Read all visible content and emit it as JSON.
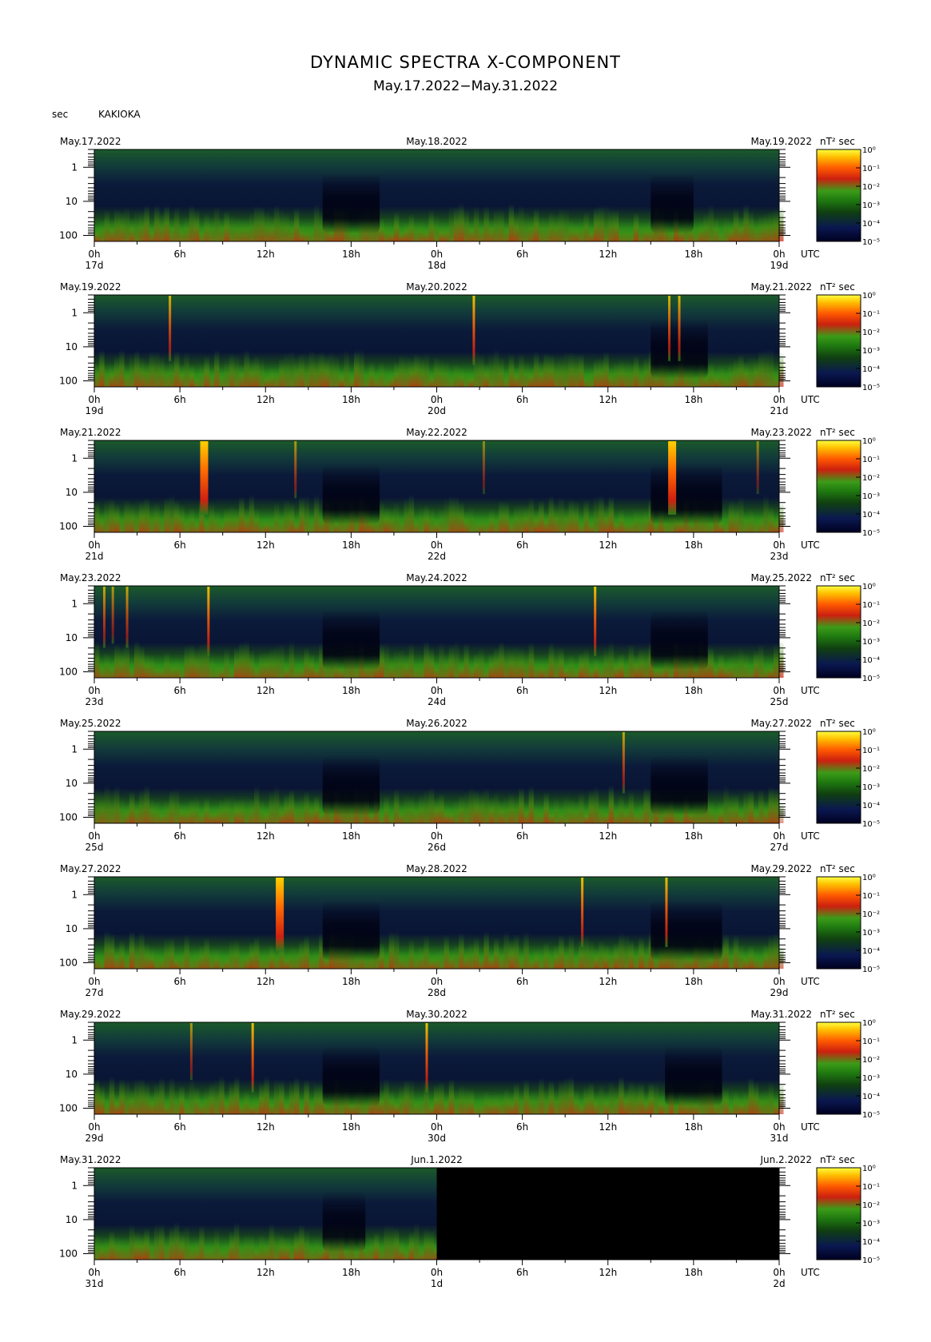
{
  "header": {
    "title": "DYNAMIC SPECTRA X-COMPONENT",
    "subtitle": "May.17.2022−May.31.2022",
    "unit_label": "sec",
    "station": "KAKIOKA"
  },
  "colors": {
    "colorbar": [
      "#000020",
      "#0a1850",
      "#104010",
      "#1f7a10",
      "#3c9b18",
      "#cc2010",
      "#ff5a00",
      "#ffc000",
      "#ffff40"
    ],
    "background_panel": "#0b1a3a",
    "no_data": "#000000"
  },
  "chart_data": {
    "type": "heatmap",
    "y_axis": {
      "label": "sec",
      "scale": "log",
      "ticks": [
        "1",
        "10",
        "100"
      ]
    },
    "x_axis": {
      "ticks": [
        "0h",
        "6h",
        "12h",
        "18h",
        "0h",
        "6h",
        "12h",
        "18h",
        "0h"
      ],
      "end_label": "UTC"
    },
    "colorbar": {
      "unit": "nT² sec",
      "ticks": [
        "10⁰",
        "10⁻¹",
        "10⁻²",
        "10⁻³",
        "10⁻⁴",
        "10⁻⁵"
      ]
    },
    "panels": [
      {
        "date_left": "May.17.2022",
        "date_mid": "May.18.2022",
        "date_right": "May.19.2022",
        "day_labels": [
          "17d",
          "18d",
          "19d"
        ],
        "data_until_hour": 48,
        "events": [],
        "quiet": [
          [
            16,
            20
          ],
          [
            39,
            42
          ]
        ]
      },
      {
        "date_left": "May.19.2022",
        "date_mid": "May.20.2022",
        "date_right": "May.21.2022",
        "day_labels": [
          "19d",
          "20d",
          "21d"
        ],
        "data_until_hour": 48,
        "events": [
          [
            5.3,
            0.8
          ],
          [
            26.6,
            0.9
          ],
          [
            40.3,
            0.8
          ],
          [
            41.0,
            0.8
          ]
        ],
        "quiet": [
          [
            39,
            43
          ]
        ]
      },
      {
        "date_left": "May.21.2022",
        "date_mid": "May.22.2022",
        "date_right": "May.23.2022",
        "day_labels": [
          "21d",
          "22d",
          "23d"
        ],
        "data_until_hour": 48,
        "events": [
          [
            7.7,
            1.0
          ],
          [
            14.1,
            0.6
          ],
          [
            27.3,
            0.5
          ],
          [
            40.5,
            1.0
          ],
          [
            46.5,
            0.5
          ]
        ],
        "quiet": [
          [
            16,
            20
          ],
          [
            39,
            44
          ]
        ]
      },
      {
        "date_left": "May.23.2022",
        "date_mid": "May.24.2022",
        "date_right": "May.25.2022",
        "day_labels": [
          "23d",
          "24d",
          "25d"
        ],
        "data_until_hour": 48,
        "events": [
          [
            0.7,
            0.7
          ],
          [
            1.3,
            0.6
          ],
          [
            2.3,
            0.7
          ],
          [
            8.0,
            0.9
          ],
          [
            35.1,
            0.9
          ]
        ],
        "quiet": [
          [
            16,
            20
          ],
          [
            39,
            43
          ]
        ]
      },
      {
        "date_left": "May.25.2022",
        "date_mid": "May.26.2022",
        "date_right": "May.27.2022",
        "day_labels": [
          "25d",
          "26d",
          "27d"
        ],
        "data_until_hour": 48,
        "events": [
          [
            37.1,
            0.7
          ]
        ],
        "quiet": [
          [
            16,
            20
          ],
          [
            39,
            43
          ]
        ]
      },
      {
        "date_left": "May.27.2022",
        "date_mid": "May.28.2022",
        "date_right": "May.29.2022",
        "day_labels": [
          "27d",
          "28d",
          "29d"
        ],
        "data_until_hour": 48,
        "events": [
          [
            13.0,
            1.0
          ],
          [
            34.2,
            0.9
          ],
          [
            40.1,
            0.9
          ]
        ],
        "quiet": [
          [
            16,
            20
          ],
          [
            39,
            44
          ]
        ]
      },
      {
        "date_left": "May.29.2022",
        "date_mid": "May.30.2022",
        "date_right": "May.31.2022",
        "day_labels": [
          "29d",
          "30d",
          "31d"
        ],
        "data_until_hour": 48,
        "events": [
          [
            6.8,
            0.6
          ],
          [
            11.1,
            0.9
          ],
          [
            23.3,
            0.9
          ]
        ],
        "quiet": [
          [
            16,
            20
          ],
          [
            40,
            44
          ]
        ]
      },
      {
        "date_left": "May.31.2022",
        "date_mid": "Jun.1.2022",
        "date_right": "Jun.2.2022",
        "day_labels": [
          "31d",
          "1d",
          "2d"
        ],
        "data_until_hour": 24,
        "events": [],
        "quiet": [
          [
            16,
            19
          ]
        ]
      }
    ]
  }
}
